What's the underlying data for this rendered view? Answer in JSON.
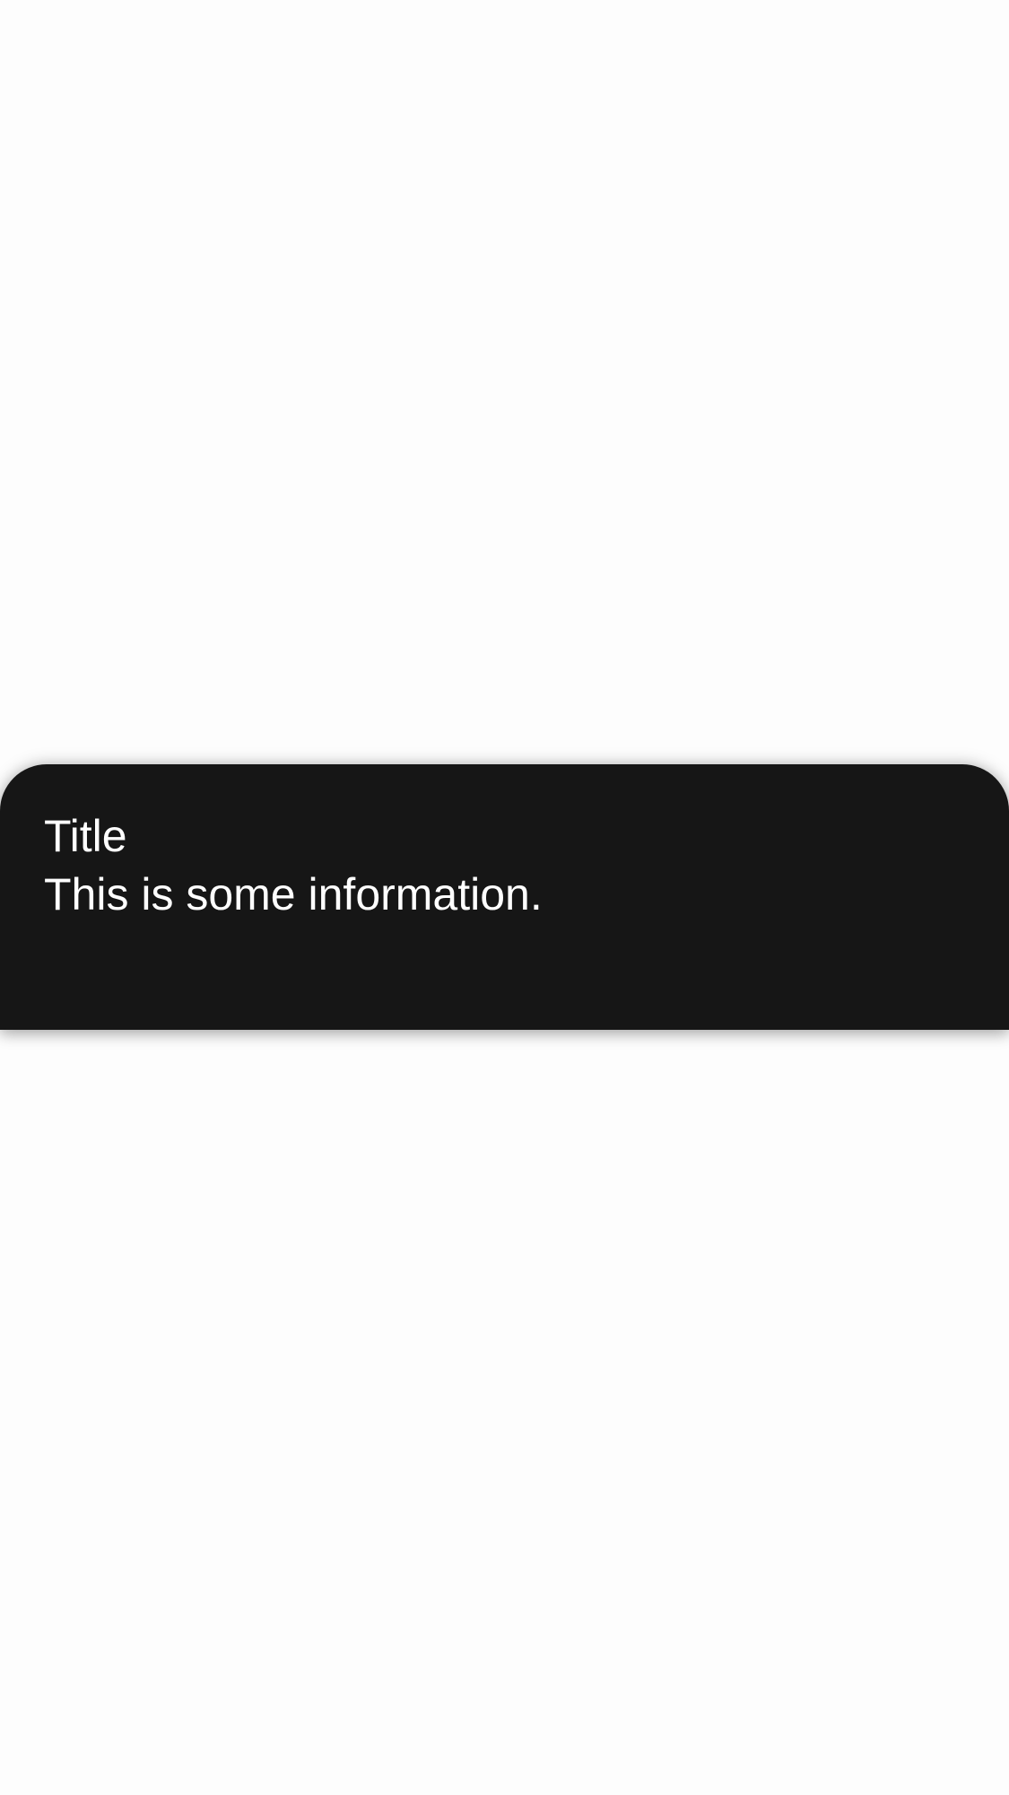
{
  "info_card": {
    "title": "Title",
    "message": "This is some information.",
    "background_color": "#161616",
    "text_color": "#ffffff"
  },
  "page": {
    "background_color": "#fdfdfd"
  }
}
